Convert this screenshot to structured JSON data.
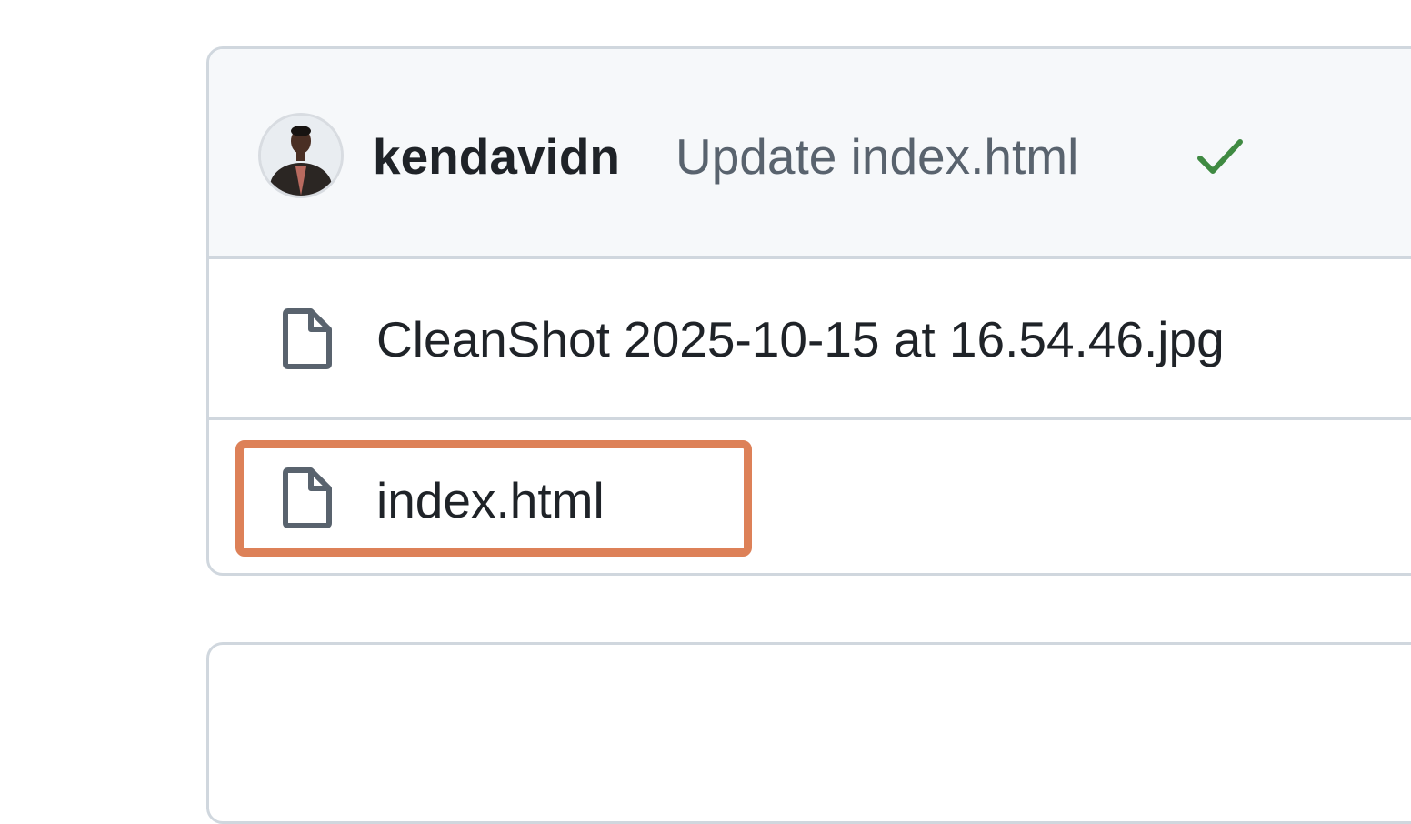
{
  "commit": {
    "author": "kendavidn",
    "message": "Update index.html",
    "status": "success",
    "status_color": "#3f8a42"
  },
  "files": [
    {
      "name": "CleanShot 2025-10-15 at 16.54.46.jpg",
      "icon": "file-icon"
    },
    {
      "name": "index.html",
      "icon": "file-icon",
      "highlighted": true
    }
  ],
  "colors": {
    "border": "#d0d7de",
    "header_bg": "#f6f8fa",
    "highlight": "#dd8158",
    "text": "#1f2328",
    "muted_text": "#59636e"
  }
}
